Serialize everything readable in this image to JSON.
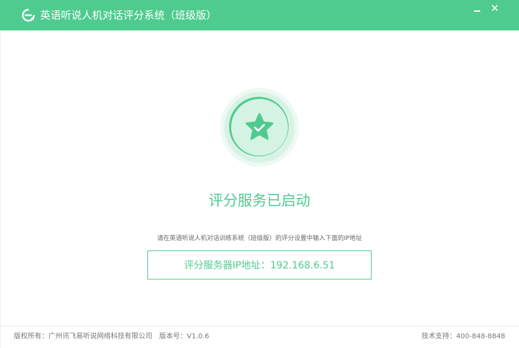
{
  "window": {
    "title": "英语听说人机对话评分系统（班级版）",
    "minimize_icon": "minimize-icon",
    "close_icon": "close-icon"
  },
  "status": {
    "icon": "star-check-icon",
    "title": "评分服务已启动",
    "hint": "请在英语听说人机对话训练系统（班级版）的评分设置中输入下面的IP地址",
    "ip_label": "评分服务器IP地址：192.168.6.51"
  },
  "footer": {
    "copyright": "版权所有：广州讯飞易听说网络科技有限公司",
    "version": "版本号：V1.0.6",
    "support": "技术支持：400-848-8848"
  },
  "colors": {
    "accent": "#4fcb8f",
    "text_muted": "#666666"
  }
}
